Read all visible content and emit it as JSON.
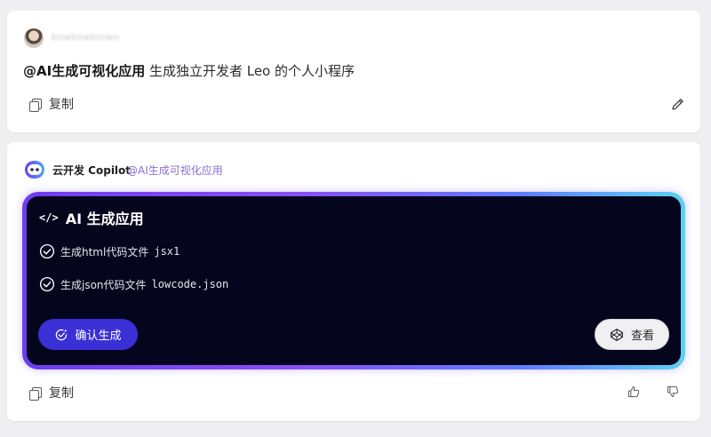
{
  "user_message": {
    "username": "bowbowblowo",
    "mention": "@AI生成可视化应用",
    "text": " 生成独立开发者 Leo 的个人小程序",
    "copy_label": "复制"
  },
  "bot_message": {
    "bot_name": "云开发 Copilot",
    "mention": "@AI生成可视化应用",
    "panel": {
      "title": "AI 生成应用",
      "steps": [
        {
          "label": "生成html代码文件",
          "file": "jsx1"
        },
        {
          "label": "生成json代码文件",
          "file": "lowcode.json"
        }
      ],
      "confirm_label": "确认生成",
      "view_label": "查看"
    },
    "copy_label": "复制"
  },
  "colors": {
    "accent": "#3b2fd6",
    "panel_bg": "#05051d",
    "gradient_start": "#6d3df0",
    "gradient_end": "#5bd2f0"
  },
  "icons": [
    "copy-icon",
    "edit-icon",
    "bot-avatar-icon",
    "code-icon",
    "check-circle-icon",
    "magic-check-icon",
    "codepen-icon",
    "thumb-up-icon",
    "thumb-down-icon"
  ]
}
